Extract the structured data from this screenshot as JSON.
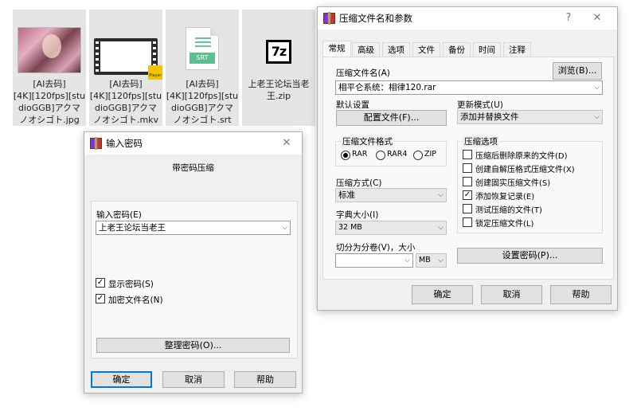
{
  "files": [
    {
      "name": "[AI去码]\n[4K][120fps][stu\ndioGGB]アクマ\nノオシゴト.jpg",
      "icon": "image-thumbnail"
    },
    {
      "name": "[AI去码]\n[4K][120fps][stu\ndioGGB]アクマ\nノオシゴト.mkv",
      "icon": "video-file-icon",
      "badge": "Player"
    },
    {
      "name": "[AI去码]\n[4K][120fps][stu\ndioGGB]アクマ\nノオシゴト.srt",
      "icon": "srt-file-icon",
      "tag": "SRT"
    },
    {
      "name": "上老王论坛当老\n王.zip",
      "icon": "7z-archive-icon",
      "tag": "7z"
    }
  ],
  "archive_dialog": {
    "title": "压缩文件名和参数",
    "help_glyph": "?",
    "close_glyph": "✕",
    "tabs": [
      "常规",
      "高级",
      "选项",
      "文件",
      "备份",
      "时间",
      "注释"
    ],
    "archive_name_label": "压缩文件名(A)",
    "browse_button": "浏览(B)...",
    "archive_name_value": "相平仑系统：相律120.rar",
    "default_settings_label": "默认设置",
    "profiles_button": "配置文件(F)...",
    "update_mode_label": "更新模式(U)",
    "update_mode_value": "添加并替换文件",
    "format_group": "压缩文件格式",
    "formats": [
      "RAR",
      "RAR4",
      "ZIP"
    ],
    "selected_format": "RAR",
    "method_label": "压缩方式(C)",
    "method_value": "标准",
    "dict_label": "字典大小(I)",
    "dict_value": "32 MB",
    "split_label": "切分为分卷(V)，大小",
    "split_value": "",
    "split_unit": "MB",
    "options_group": "压缩选项",
    "options": [
      {
        "label": "压缩后删除原来的文件(D)",
        "checked": false
      },
      {
        "label": "创建自解压格式压缩文件(X)",
        "checked": false
      },
      {
        "label": "创建固实压缩文件(S)",
        "checked": false
      },
      {
        "label": "添加恢复记录(E)",
        "checked": true
      },
      {
        "label": "测试压缩的文件(T)",
        "checked": false
      },
      {
        "label": "锁定压缩文件(L)",
        "checked": false
      }
    ],
    "set_password_button": "设置密码(P)...",
    "ok_button": "确定",
    "cancel_button": "取消",
    "help_button": "帮助"
  },
  "password_dialog": {
    "title": "输入密码",
    "close_glyph": "✕",
    "heading": "带密码压缩",
    "enter_label": "输入密码(E)",
    "password_value": "上老王论坛当老王",
    "show_password": {
      "label": "显示密码(S)",
      "checked": true
    },
    "encrypt_names": {
      "label": "加密文件名(N)",
      "checked": true
    },
    "organize_button": "整理密码(O)...",
    "ok_button": "确定",
    "cancel_button": "取消",
    "help_button": "帮助"
  },
  "check_glyph": "✓",
  "arrow_glyph": "⌵"
}
